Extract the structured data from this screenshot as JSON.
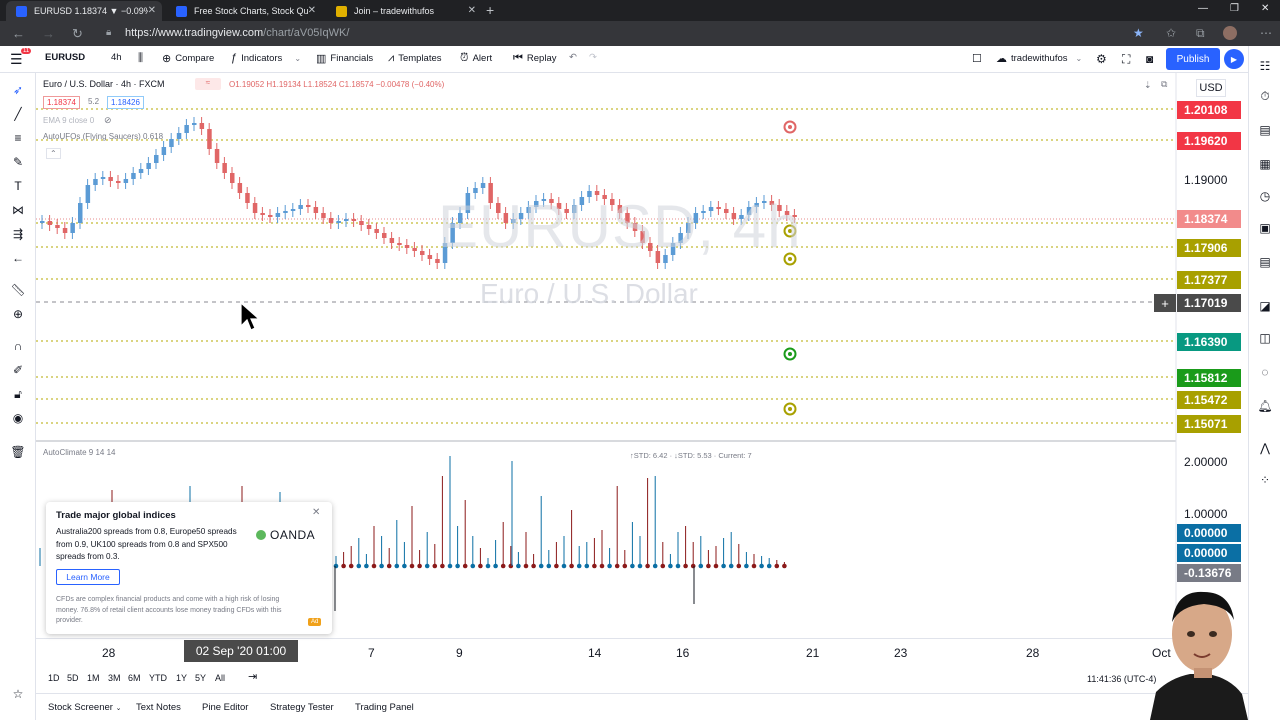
{
  "browser": {
    "tabs": [
      {
        "title": "EURUSD 1.18374 ▼ −0.09% trad",
        "active": true,
        "favicon_color": "#2962ff"
      },
      {
        "title": "Free Stock Charts, Stock Quotes",
        "active": false,
        "favicon_color": "#2962ff"
      },
      {
        "title": "Join – tradewithufos",
        "active": false,
        "favicon_color": "#e0b000"
      }
    ],
    "url_host": "https://www.tradingview.com",
    "url_path": "/chart/aV05IqWK/"
  },
  "toolbar": {
    "notification_count": "11",
    "symbol": "EURUSD",
    "interval": "4h",
    "compare": "Compare",
    "indicators": "Indicators",
    "financials": "Financials",
    "templates": "Templates",
    "alert": "Alert",
    "replay": "Replay",
    "layout_name": "tradewithufos",
    "publish": "Publish"
  },
  "legend": {
    "title": "Euro / U.S. Dollar · 4h · FXCM",
    "ohlc": "O1.19052  H1.19134  L1.18524  C1.18574  −0.00478 (−0.40%)",
    "bid": "1.18374",
    "spread": "5.2",
    "ask": "1.18426",
    "ema": "EMA 9 close 0",
    "ufos": "AutoUFOs (Flying Saucers) 0.618",
    "climate": "AutoClimate 9 14 14",
    "climate_stats": "↑STD: 6.42 · ↓STD: 5.53 · Current: 7"
  },
  "watermark": {
    "symbol": "EURUSD, 4h",
    "name": "Euro / U.S. Dollar"
  },
  "price_axis": {
    "currency": "USD",
    "labels": [
      {
        "text": "1.20108",
        "color": "#f23645",
        "kind": "filled"
      },
      {
        "text": "1.19620",
        "color": "#f23645",
        "kind": "filled"
      },
      {
        "text": "1.19000",
        "color": "",
        "kind": "plain"
      },
      {
        "text": "1.18374",
        "color": "#f28b8b",
        "kind": "filled"
      },
      {
        "text": "1.17906",
        "color": "#a8a000",
        "kind": "filled"
      },
      {
        "text": "1.17377",
        "color": "#a8a000",
        "kind": "filled"
      },
      {
        "text": "1.17019",
        "color": "#4a4a4a",
        "kind": "filled"
      },
      {
        "text": "1.16390",
        "color": "#089981",
        "kind": "filled"
      },
      {
        "text": "1.15812",
        "color": "#1a9b1a",
        "kind": "filled"
      },
      {
        "text": "1.15472",
        "color": "#a8a000",
        "kind": "filled"
      },
      {
        "text": "1.15071",
        "color": "#a8a000",
        "kind": "filled"
      }
    ],
    "osc_labels": [
      {
        "text": "2.00000",
        "color": "",
        "kind": "plain"
      },
      {
        "text": "1.00000",
        "color": "",
        "kind": "plain"
      },
      {
        "text": "0.00000",
        "color": "#0b6fa4",
        "kind": "filled"
      },
      {
        "text": "0.00000",
        "color": "#0b6fa4",
        "kind": "filled"
      },
      {
        "text": "-0.13676",
        "color": "#787b86",
        "kind": "filled"
      },
      {
        "text": "-1",
        "color": "",
        "kind": "plain"
      }
    ]
  },
  "date_axis": {
    "labels": [
      "28",
      "7",
      "9",
      "14",
      "16",
      "21",
      "23",
      "28",
      "Oct"
    ],
    "crosshair": "02 Sep '20   01:00"
  },
  "range_buttons": [
    "1D",
    "5D",
    "1M",
    "3M",
    "6M",
    "YTD",
    "1Y",
    "5Y",
    "All"
  ],
  "clock": "11:41:36 (UTC-4)",
  "bottom_tabs": [
    "Stock Screener",
    "Text Notes",
    "Pine Editor",
    "Strategy Tester",
    "Trading Panel"
  ],
  "ad": {
    "title": "Trade major global indices",
    "body": "Australia200 spreads from 0.8, Europe50 spreads from 0.9, UK100 spreads from 0.8 and SPX500 spreads from 0.3.",
    "brand": "OANDA",
    "cta": "Learn More",
    "disclaimer": "CFDs are complex financial products and come with a high risk of losing money. 76.8% of retail client accounts lose money trading CFDs with this provider.",
    "tag": "Ad"
  },
  "colors": {
    "up_candle": "#5b9bd5",
    "down_candle": "#e06666",
    "level_line": "#b5a800",
    "accent": "#2962ff"
  },
  "icons": [
    "cursor-icon",
    "trendline-icon",
    "fib-icon",
    "brush-icon",
    "text-icon",
    "pattern-icon",
    "prediction-icon",
    "back-arrow-icon",
    "ruler-icon",
    "zoom-icon",
    "magnet-icon",
    "lock-icon",
    "eye-icon",
    "trash-icon",
    "star-icon"
  ]
}
